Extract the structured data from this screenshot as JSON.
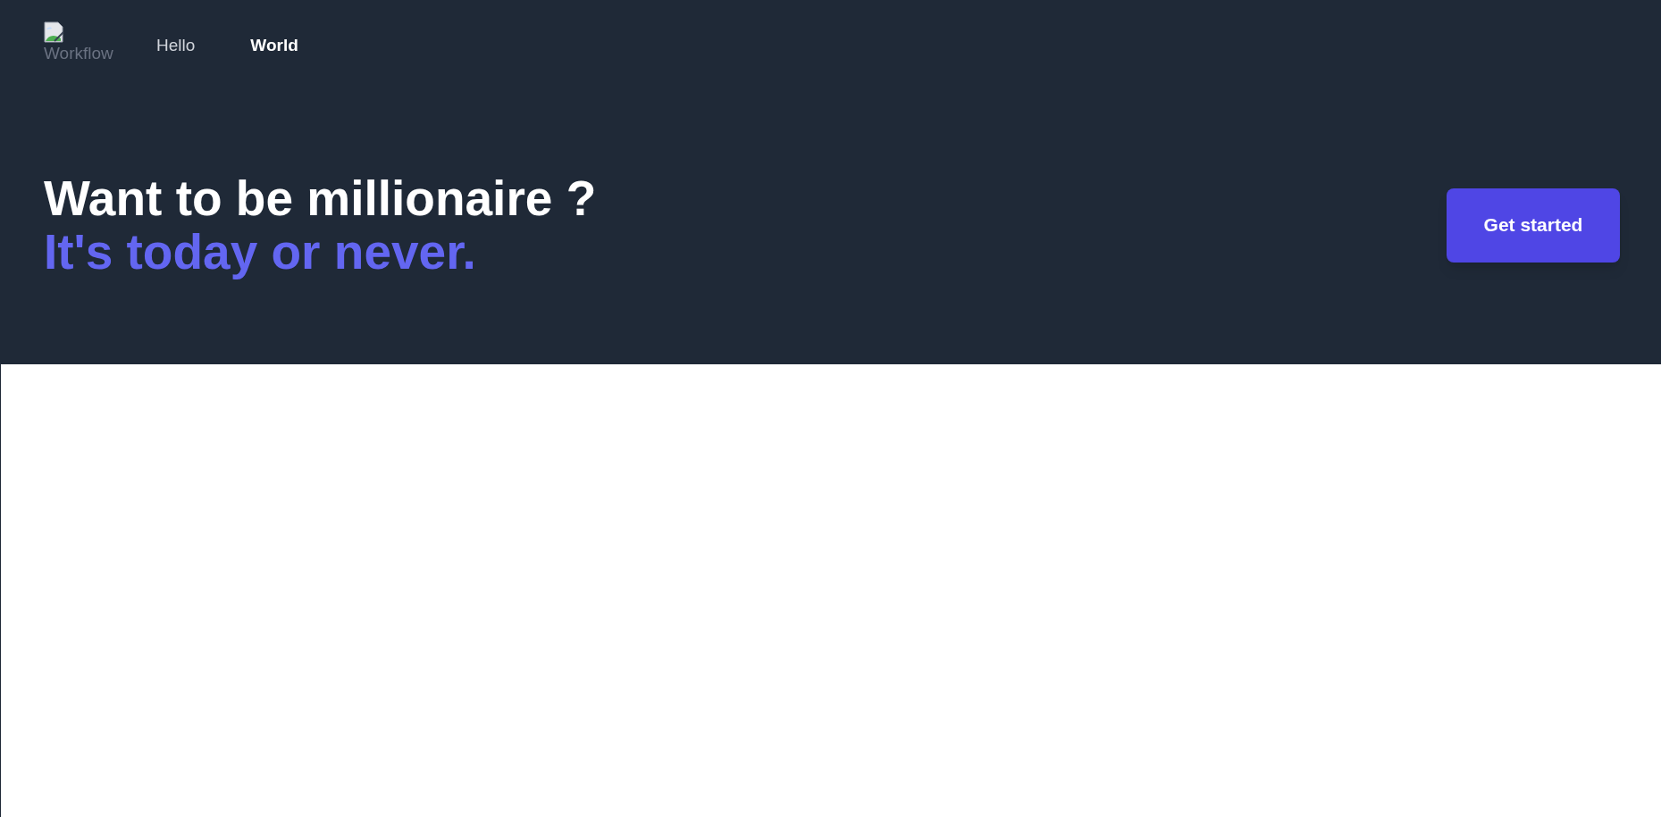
{
  "logo": {
    "alt": "Workflow"
  },
  "nav": [
    {
      "label": "Hello",
      "selected": false
    },
    {
      "label": "World",
      "selected": true
    }
  ],
  "hero": {
    "title": "Want to be millionaire ?",
    "subtitle": "It's today or never.",
    "button": "Get started"
  }
}
